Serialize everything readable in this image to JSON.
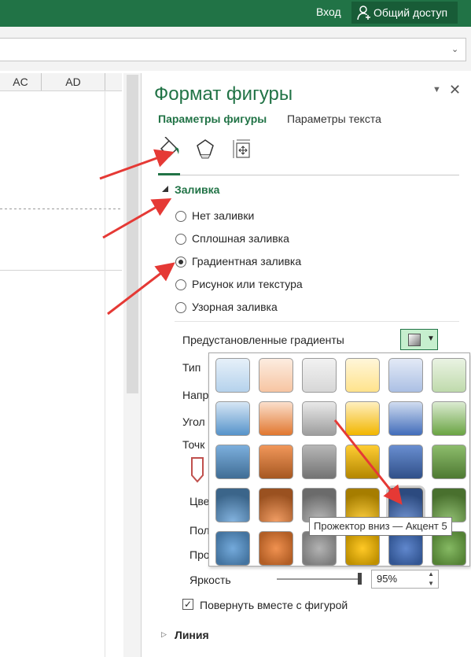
{
  "topbar": {
    "login": "Вход",
    "share": "Общий доступ"
  },
  "grid": {
    "columns": [
      "AC",
      "AD"
    ]
  },
  "pane": {
    "title": "Формат фигуры",
    "tabs": [
      "Параметры фигуры",
      "Параметры текста"
    ],
    "icons": [
      "fill-line-icon",
      "effects-pentagon-icon",
      "size-properties-icon"
    ],
    "fill": {
      "heading": "Заливка",
      "options": [
        "Нет заливки",
        "Сплошная заливка",
        "Градиентная заливка",
        "Рисунок или текстура",
        "Узорная заливка"
      ],
      "selected_index": 2
    },
    "gradient": {
      "presets_label": "Предустановленные градиенты",
      "type_label": "Тип",
      "direction_label": "Напр",
      "angle_label": "Угол",
      "stops_label": "Точк",
      "color_label": "Цве",
      "position_label": "Пол",
      "transparency_label": "Про",
      "brightness_label": "Яркость",
      "brightness_value": "95%",
      "brightness_fraction": 0.95,
      "rotate_label": "Повернуть вместе с фигурой",
      "rotate_checked": true
    },
    "line": {
      "heading": "Линия"
    }
  },
  "gallery": {
    "tooltip": "Прожектор вниз — Акцент 5",
    "highlighted": [
      3,
      4
    ],
    "accent_colors": [
      "#5b9bd5",
      "#ed7d31",
      "#a5a5a5",
      "#ffc000",
      "#4472c4",
      "#70ad47"
    ],
    "rows": [
      "light-linear",
      "medium-linear",
      "top-spotlight",
      "bottom-spotlight",
      "radial"
    ]
  },
  "colors": {
    "accent": "#217346",
    "arrow": "#e53935"
  }
}
